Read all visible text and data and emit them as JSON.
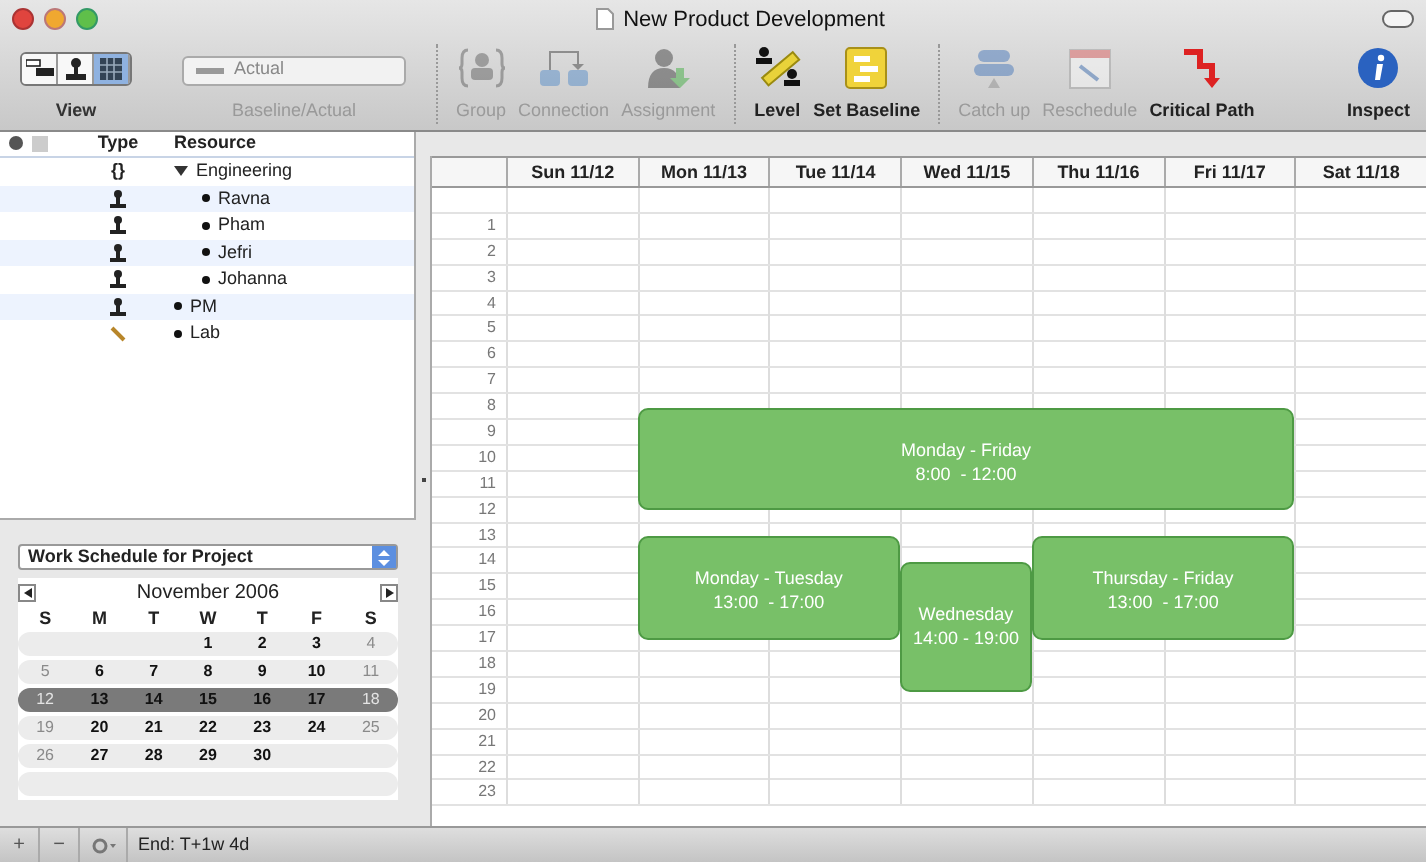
{
  "window": {
    "title": "New Product Development"
  },
  "toolbar": {
    "view": {
      "label": "View",
      "segments": [
        {
          "kind": "gantt",
          "selected": false
        },
        {
          "kind": "resource",
          "selected": false
        },
        {
          "kind": "calendar",
          "selected": true
        }
      ]
    },
    "baseline": {
      "label": "Baseline/Actual",
      "value": "Actual",
      "disabled": true
    },
    "groups": [
      [
        {
          "kind": "group",
          "label": "Group",
          "disabled": true
        },
        {
          "kind": "connection",
          "label": "Connection",
          "disabled": true
        },
        {
          "kind": "assignment",
          "label": "Assignment",
          "disabled": true
        }
      ],
      [
        {
          "kind": "level",
          "label": "Level",
          "disabled": false
        },
        {
          "kind": "baseline",
          "label": "Set Baseline",
          "disabled": false
        }
      ],
      [
        {
          "kind": "catchup",
          "label": "Catch up",
          "disabled": true
        },
        {
          "kind": "reschedule",
          "label": "Reschedule",
          "disabled": true
        },
        {
          "kind": "critical",
          "label": "Critical Path",
          "disabled": false
        }
      ]
    ],
    "inspect": {
      "label": "Inspect"
    }
  },
  "resources": {
    "columns": [
      "Type",
      "Resource"
    ],
    "rows": [
      {
        "kind": "group",
        "glyph": "{}",
        "name": "Engineering",
        "expanded": true,
        "children": [
          {
            "kind": "person",
            "name": "Ravna"
          },
          {
            "kind": "person",
            "name": "Pham"
          },
          {
            "kind": "person",
            "name": "Jefri"
          },
          {
            "kind": "person",
            "name": "Johanna"
          }
        ]
      },
      {
        "kind": "person",
        "name": "PM"
      },
      {
        "kind": "material",
        "name": "Lab"
      }
    ]
  },
  "schedule": {
    "value": "Work Schedule for Project"
  },
  "mini_calendar": {
    "month": "November 2006",
    "weekdays": [
      "S",
      "M",
      "T",
      "W",
      "T",
      "F",
      "S"
    ],
    "weeks": [
      {
        "selected": false,
        "days": [
          {
            "label": "1",
            "dim": false
          },
          {
            "label": "2",
            "dim": false
          },
          {
            "label": "3",
            "dim": false
          },
          {
            "label": "4",
            "dim": true
          }
        ]
      },
      {
        "selected": false,
        "days": [
          {
            "label": "5",
            "dim": true
          },
          {
            "label": "6",
            "dim": false
          },
          {
            "label": "7",
            "dim": false
          },
          {
            "label": "8",
            "dim": false
          },
          {
            "label": "9",
            "dim": false
          },
          {
            "label": "10",
            "dim": false
          },
          {
            "label": "11",
            "dim": true
          }
        ]
      },
      {
        "selected": true,
        "days": [
          {
            "label": "12",
            "dim": true
          },
          {
            "label": "13",
            "dim": false
          },
          {
            "label": "14",
            "dim": false
          },
          {
            "label": "15",
            "dim": false
          },
          {
            "label": "16",
            "dim": false
          },
          {
            "label": "17",
            "dim": false
          },
          {
            "label": "18",
            "dim": true
          }
        ]
      },
      {
        "selected": false,
        "days": [
          {
            "label": "19",
            "dim": true
          },
          {
            "label": "20",
            "dim": false
          },
          {
            "label": "21",
            "dim": false
          },
          {
            "label": "22",
            "dim": false
          },
          {
            "label": "23",
            "dim": false
          },
          {
            "label": "24",
            "dim": false
          },
          {
            "label": "25",
            "dim": true
          }
        ]
      },
      {
        "selected": false,
        "days": [
          {
            "label": "26",
            "dim": true
          },
          {
            "label": "27",
            "dim": false
          },
          {
            "label": "28",
            "dim": false
          },
          {
            "label": "29",
            "dim": false
          },
          {
            "label": "30",
            "dim": false
          }
        ]
      }
    ]
  },
  "bottom_bar": {
    "add": "+",
    "remove": "−",
    "end": "End: T+1w 4d"
  },
  "calendar": {
    "days": [
      "Sun 11/12",
      "Mon 11/13",
      "Tue 11/14",
      "Wed 11/15",
      "Thu 11/16",
      "Fri 11/17",
      "Sat 11/18"
    ],
    "hours": [
      "1",
      "2",
      "3",
      "4",
      "5",
      "6",
      "7",
      "8",
      "9",
      "10",
      "11",
      "12",
      "13",
      "14",
      "15",
      "16",
      "17",
      "18",
      "19",
      "20",
      "21",
      "22",
      "23"
    ],
    "blocks": [
      {
        "title": "Monday - Friday",
        "time": "8:00  - 12:00"
      },
      {
        "title": "Monday - Tuesday",
        "time": "13:00  - 17:00"
      },
      {
        "title": "Wednesday",
        "time": "14:00 - 19:00"
      },
      {
        "title": "Thursday - Friday",
        "time": "13:00  - 17:00"
      }
    ]
  }
}
